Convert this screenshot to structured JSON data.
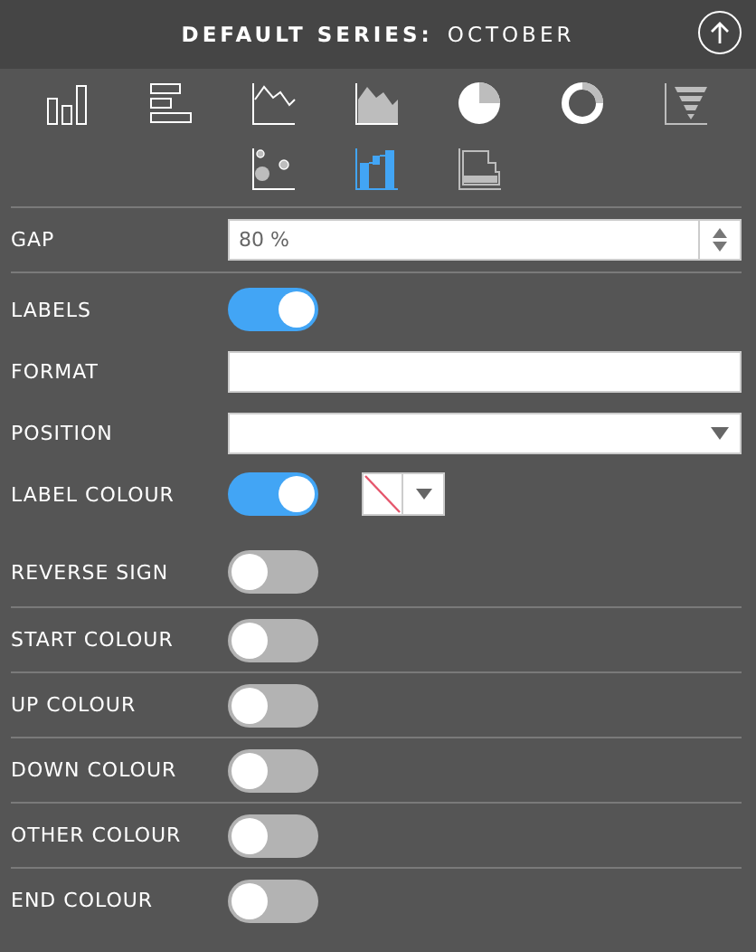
{
  "header": {
    "title": "DEFAULT SERIES:",
    "series": "OCTOBER"
  },
  "chart_types": [
    {
      "kind": "column",
      "selected": false
    },
    {
      "kind": "bar",
      "selected": false
    },
    {
      "kind": "line",
      "selected": false
    },
    {
      "kind": "area",
      "selected": false
    },
    {
      "kind": "pie",
      "selected": false
    },
    {
      "kind": "donut",
      "selected": false
    },
    {
      "kind": "funnel",
      "selected": false
    },
    {
      "kind": "scatter",
      "selected": false
    },
    {
      "kind": "waterfall",
      "selected": true
    },
    {
      "kind": "step",
      "selected": false
    }
  ],
  "sections": [
    {
      "rows": [
        {
          "kind": "spinner",
          "label": "GAP",
          "value": "80 %"
        }
      ]
    },
    {
      "rows": [
        {
          "kind": "toggle",
          "label": "LABELS",
          "on": true
        },
        {
          "kind": "text",
          "label": "FORMAT"
        },
        {
          "kind": "select",
          "label": "POSITION"
        },
        {
          "kind": "toggle_colour",
          "label": "LABEL COLOUR",
          "on": true
        },
        {
          "kind": "toggle",
          "label": "REVERSE SIGN",
          "on": false
        }
      ]
    },
    {
      "rows": [
        {
          "kind": "toggle",
          "label": "START COLOUR",
          "on": false
        }
      ]
    },
    {
      "rows": [
        {
          "kind": "toggle",
          "label": "UP COLOUR",
          "on": false
        }
      ]
    },
    {
      "rows": [
        {
          "kind": "toggle",
          "label": "DOWN COLOUR",
          "on": false
        }
      ]
    },
    {
      "rows": [
        {
          "kind": "toggle",
          "label": "OTHER COLOUR",
          "on": false
        }
      ]
    },
    {
      "rows": [
        {
          "kind": "toggle",
          "label": "END COLOUR",
          "on": false
        }
      ]
    }
  ]
}
